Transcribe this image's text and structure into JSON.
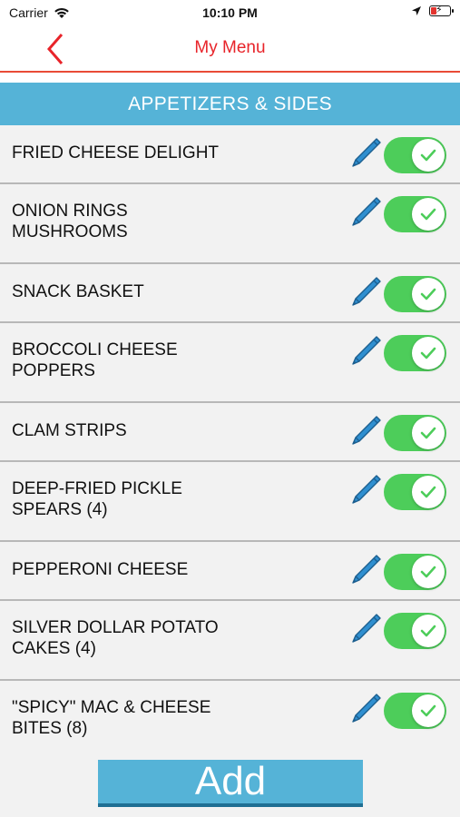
{
  "status_bar": {
    "carrier": "Carrier",
    "time": "10:10 PM"
  },
  "nav": {
    "title": "My Menu",
    "back_icon": "chevron-left-icon"
  },
  "section": {
    "title": "APPETIZERS & SIDES"
  },
  "items": [
    {
      "label": "FRIED CHEESE DELIGHT",
      "enabled": true
    },
    {
      "label": "ONION RINGS\nMUSHROOMS",
      "enabled": true
    },
    {
      "label": "SNACK BASKET",
      "enabled": true
    },
    {
      "label": "BROCCOLI CHEESE\nPOPPERS",
      "enabled": true
    },
    {
      "label": "CLAM STRIPS",
      "enabled": true
    },
    {
      "label": "DEEP-FRIED PICKLE\nSPEARS (4)",
      "enabled": true
    },
    {
      "label": "PEPPERONI CHEESE",
      "enabled": true
    },
    {
      "label": "SILVER DOLLAR POTATO\nCAKES (4)",
      "enabled": true
    },
    {
      "label": "\"SPICY\" MAC & CHEESE\nBITES (8)",
      "enabled": true
    }
  ],
  "footer": {
    "add_label": "Add"
  },
  "colors": {
    "accent_red": "#e8242a",
    "header_blue": "#55b3d7",
    "toggle_green": "#4dcd5a",
    "pencil_blue": "#2f8fd0"
  }
}
